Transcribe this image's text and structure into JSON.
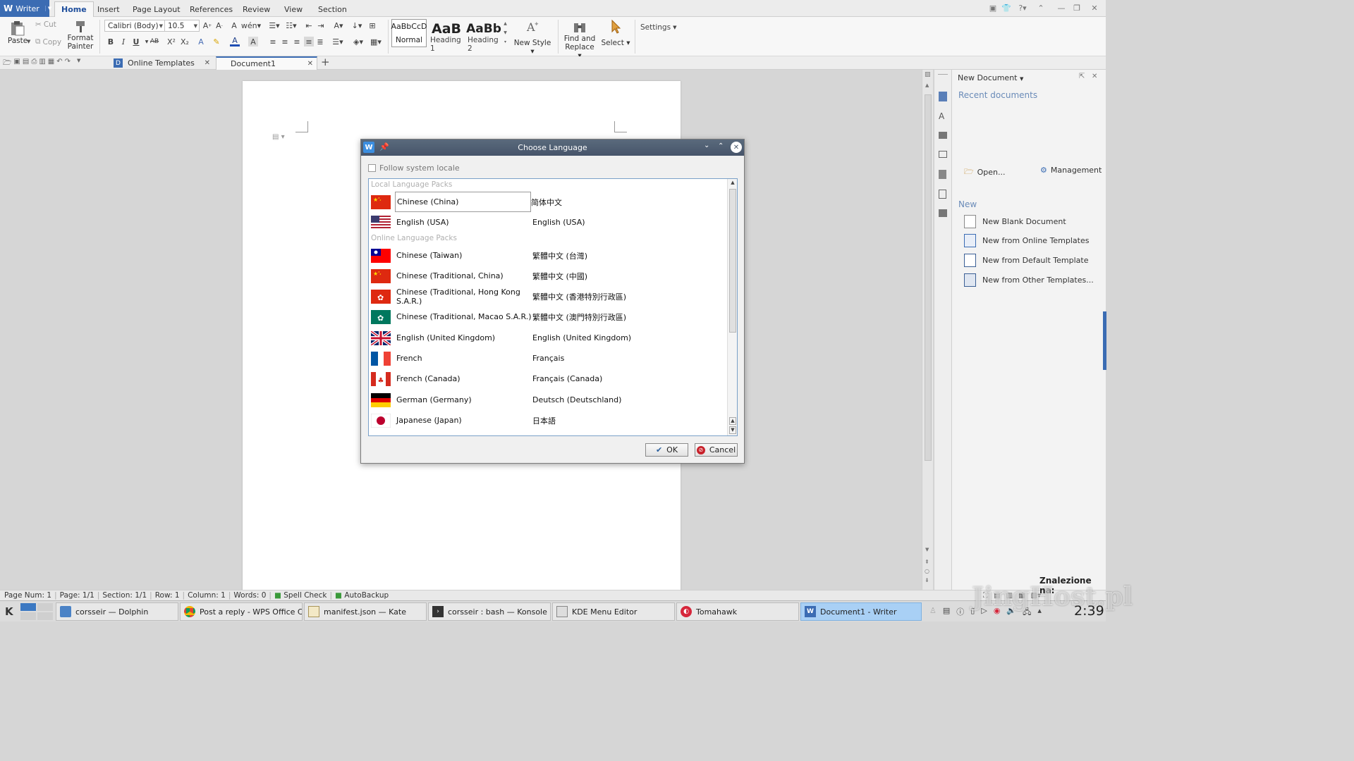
{
  "app": {
    "name": "Writer"
  },
  "menu": {
    "tabs": [
      "Home",
      "Insert",
      "Page Layout",
      "References",
      "Review",
      "View",
      "Section"
    ],
    "active": "Home"
  },
  "ribbon": {
    "paste": "Paste",
    "cut": "Cut",
    "copy": "Copy",
    "format_painter_1": "Format",
    "format_painter_2": "Painter",
    "font_name": "Calibri (Body)",
    "font_size": "10.5",
    "styles": [
      {
        "preview": "AaBbCcD",
        "label": "Normal"
      },
      {
        "preview": "AaB",
        "label": "Heading 1"
      },
      {
        "preview": "AaBb",
        "label": "Heading 2"
      }
    ],
    "new_style": "New Style",
    "find_replace_1": "Find and",
    "find_replace_2": "Replace",
    "select": "Select",
    "settings": "Settings"
  },
  "tabs": {
    "online_templates": "Online Templates",
    "document": "Document1"
  },
  "taskpane": {
    "header": "New Document",
    "recent": "Recent documents",
    "open": "Open...",
    "management": "Management",
    "new_heading": "New",
    "items": [
      "New Blank Document",
      "New from Online Templates",
      "New from Default Template",
      "New from Other Templates..."
    ]
  },
  "dialog": {
    "title": "Choose Language",
    "follow_locale": "Follow system locale",
    "local_group": "Local Language Packs",
    "online_group": "Online Language Packs",
    "local": [
      {
        "name": "Chinese (China)",
        "native": "简体中文",
        "flag": "cn"
      },
      {
        "name": "English (USA)",
        "native": "English (USA)",
        "flag": "us"
      }
    ],
    "online": [
      {
        "name": "Chinese (Taiwan)",
        "native": "繁體中文 (台灣)",
        "flag": "tw"
      },
      {
        "name": "Chinese (Traditional, China)",
        "native": "繁體中文 (中國)",
        "flag": "cn"
      },
      {
        "name": "Chinese (Traditional, Hong Kong S.A.R.)",
        "native": "繁體中文 (香港特別行政區)",
        "flag": "hk"
      },
      {
        "name": "Chinese (Traditional, Macao S.A.R.)",
        "native": "繁體中文 (澳門特別行政區)",
        "flag": "mo"
      },
      {
        "name": "English (United Kingdom)",
        "native": "English (United Kingdom)",
        "flag": "gb"
      },
      {
        "name": "French",
        "native": "Français",
        "flag": "fr"
      },
      {
        "name": "French (Canada)",
        "native": "Français (Canada)",
        "flag": "ca"
      },
      {
        "name": "German (Germany)",
        "native": "Deutsch (Deutschland)",
        "flag": "de"
      },
      {
        "name": "Japanese (Japan)",
        "native": "日本語",
        "flag": "jp"
      }
    ],
    "ok": "OK",
    "cancel": "Cancel"
  },
  "status": {
    "page_num": "Page Num: 1",
    "page": "Page: 1/1",
    "section": "Section: 1/1",
    "row": "Row: 1",
    "column": "Column: 1",
    "words": "Words: 0",
    "spell": "Spell Check",
    "autobackup": "AutoBackup"
  },
  "taskbar": {
    "tasks": [
      {
        "label": "corsseir — Dolphin",
        "icon": "dolphin-icon"
      },
      {
        "label": "Post a reply - WPS Office Cor",
        "icon": "chrome-icon"
      },
      {
        "label": "manifest.json  — Kate",
        "icon": "kate-icon"
      },
      {
        "label": "corsseir : bash — Konsole",
        "icon": "konsole-icon"
      },
      {
        "label": "KDE Menu Editor",
        "icon": "kde-menu-editor-icon"
      },
      {
        "label": "Tomahawk",
        "icon": "tomahawk-icon"
      },
      {
        "label": "Document1 - Writer",
        "icon": "wps-writer-icon"
      }
    ],
    "clock": "2:39"
  },
  "watermark": {
    "line1": "Znalezione na:",
    "line2": "JingHost.pl"
  },
  "colors": {
    "accent": "#3b6cb3",
    "taskbar_active": "#a9d0f5",
    "dialog_title": "#4e5d70"
  }
}
